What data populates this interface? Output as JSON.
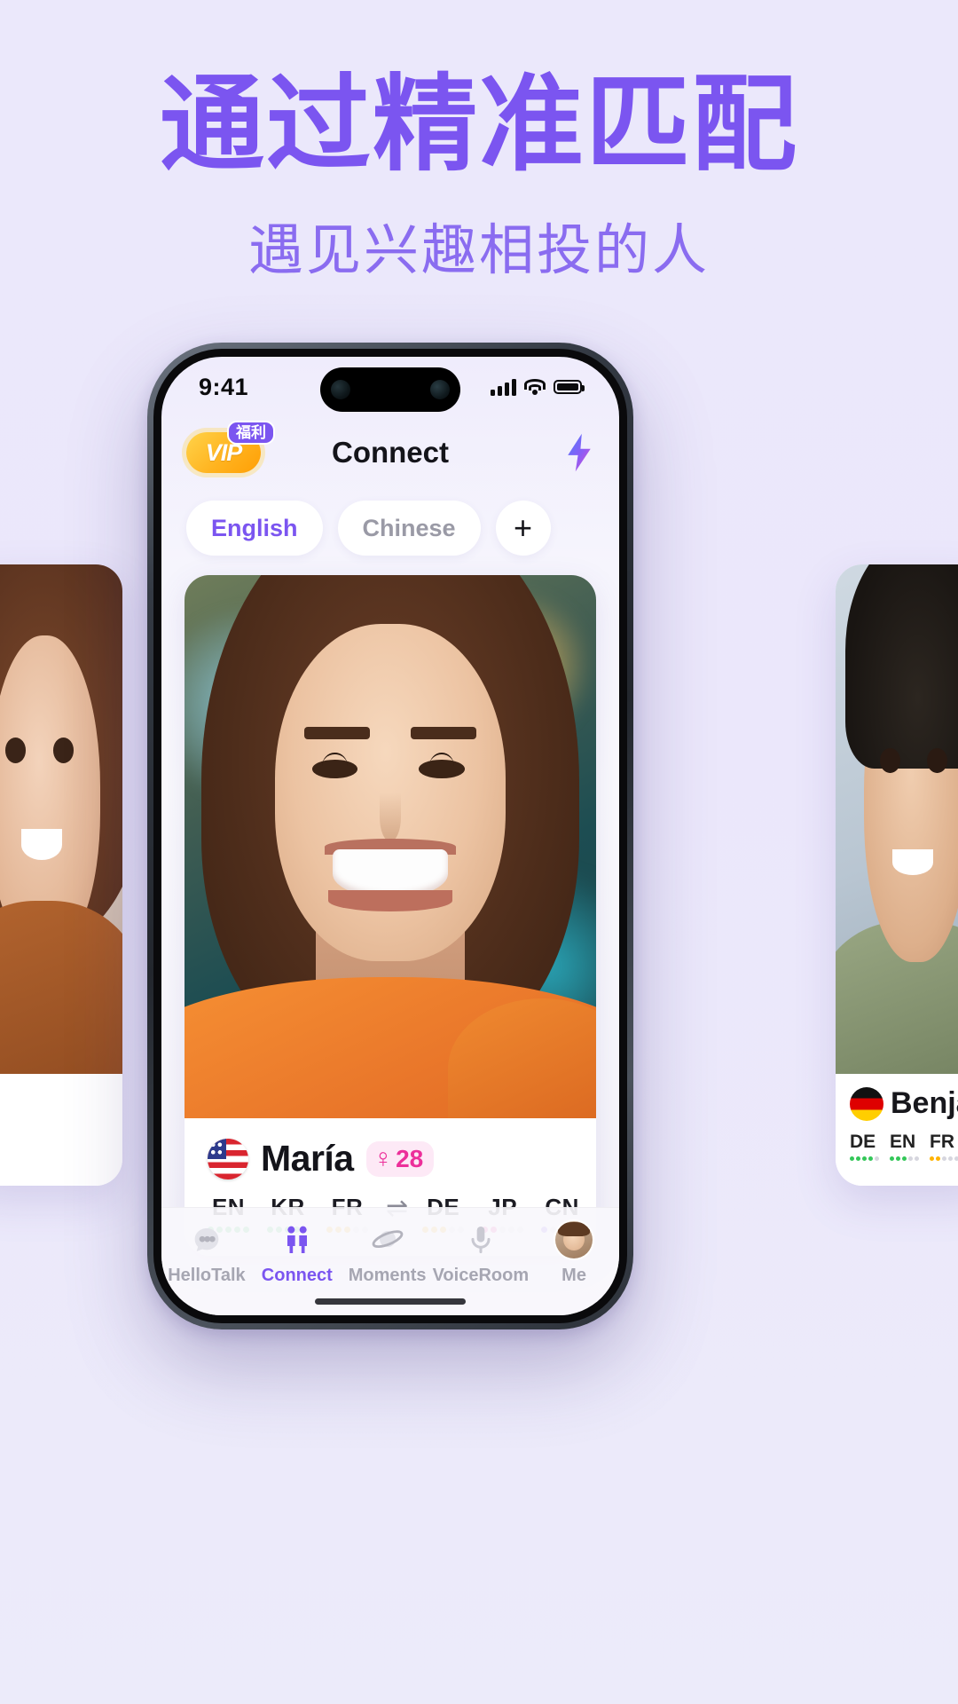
{
  "promo": {
    "headline": "通过精准匹配",
    "subheadline": "遇见兴趣相投的人",
    "accent_color": "#7b55f0",
    "background_color": "#ebe8fb"
  },
  "phone": {
    "status_bar": {
      "time": "9:41",
      "signal_icon": "cellular-bars-icon",
      "wifi_icon": "wifi-icon",
      "battery_icon": "battery-icon"
    },
    "header": {
      "vip_label": "VIP",
      "vip_tag": "福利",
      "title": "Connect",
      "action_icon": "lightning-bolt-icon"
    },
    "filters": {
      "chips": [
        {
          "label": "English",
          "active": true
        },
        {
          "label": "Chinese",
          "active": false
        }
      ],
      "add_label": "+"
    },
    "card": {
      "flag": "us-flag-icon",
      "name": "María",
      "gender_symbol": "♀",
      "age": "28",
      "languages": [
        {
          "code": "EN",
          "level": 5,
          "color": "#34c759"
        },
        {
          "code": "KR",
          "level": 4,
          "color": "#34c759"
        },
        {
          "code": "FR",
          "level": 3,
          "color": "#ffb300"
        },
        {
          "code": "DE",
          "level": 3,
          "color": "#ffb300"
        },
        {
          "code": "JP",
          "level": 2,
          "color": "#ec2f9a"
        },
        {
          "code": "CN",
          "level": 1,
          "color": "#7b55f0"
        }
      ],
      "swap_icon": "⇌"
    },
    "tabbar": [
      {
        "label": "HelloTalk",
        "icon": "chat-bubble-icon",
        "active": false
      },
      {
        "label": "Connect",
        "icon": "people-connect-icon",
        "active": true
      },
      {
        "label": "Moments",
        "icon": "planet-icon",
        "active": false
      },
      {
        "label": "VoiceRoom",
        "icon": "microphone-icon",
        "active": false
      },
      {
        "label": "Me",
        "icon": "avatar-icon",
        "active": false
      }
    ]
  },
  "peek_cards": {
    "left": {
      "name": "",
      "languages": []
    },
    "right": {
      "flag": "de-flag-icon",
      "name": "Benja",
      "languages": [
        {
          "code": "DE",
          "color": "#34c759"
        },
        {
          "code": "EN",
          "color": "#34c759"
        },
        {
          "code": "FR",
          "color": "#ffb300"
        }
      ]
    }
  }
}
